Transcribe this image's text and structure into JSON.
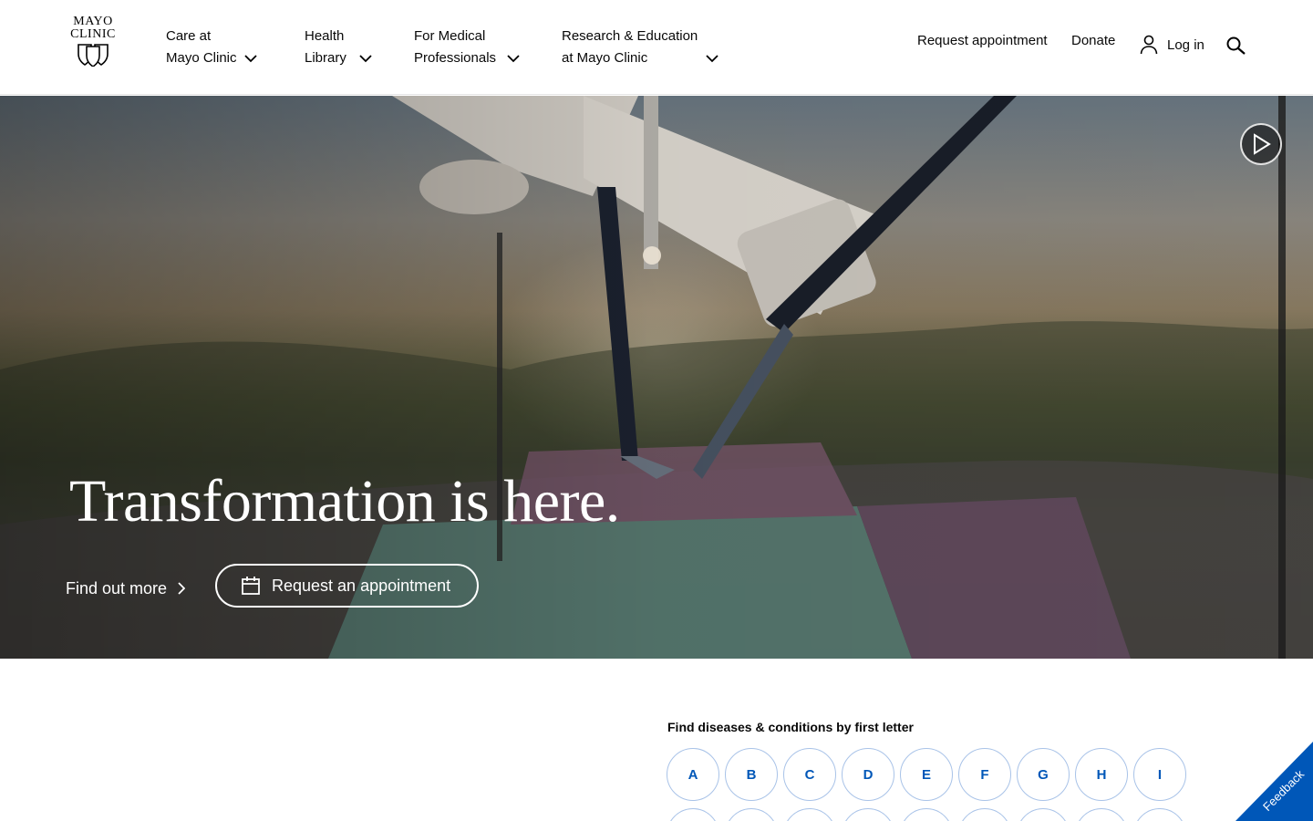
{
  "header": {
    "logo": {
      "line1": "MAYO",
      "line2": "CLINIC"
    },
    "nav": [
      {
        "line1": "Care at",
        "line2": "Mayo Clinic"
      },
      {
        "line1": "Health",
        "line2": "Library"
      },
      {
        "line1": "For Medical",
        "line2": "Professionals"
      },
      {
        "line1": "Research & Education",
        "line2": "at Mayo Clinic"
      }
    ],
    "utility": {
      "request_appointment": "Request appointment",
      "donate": "Donate",
      "login": "Log in"
    }
  },
  "hero": {
    "title": "Transformation is here.",
    "find_more": "Find out more",
    "request_appointment": "Request an appointment"
  },
  "az": {
    "title": "Find diseases & conditions by first letter",
    "letters": [
      "A",
      "B",
      "C",
      "D",
      "E",
      "F",
      "G",
      "H",
      "I"
    ]
  },
  "feedback": {
    "label": "Feedback"
  },
  "colors": {
    "accent": "#0057b8",
    "text": "#080808"
  }
}
